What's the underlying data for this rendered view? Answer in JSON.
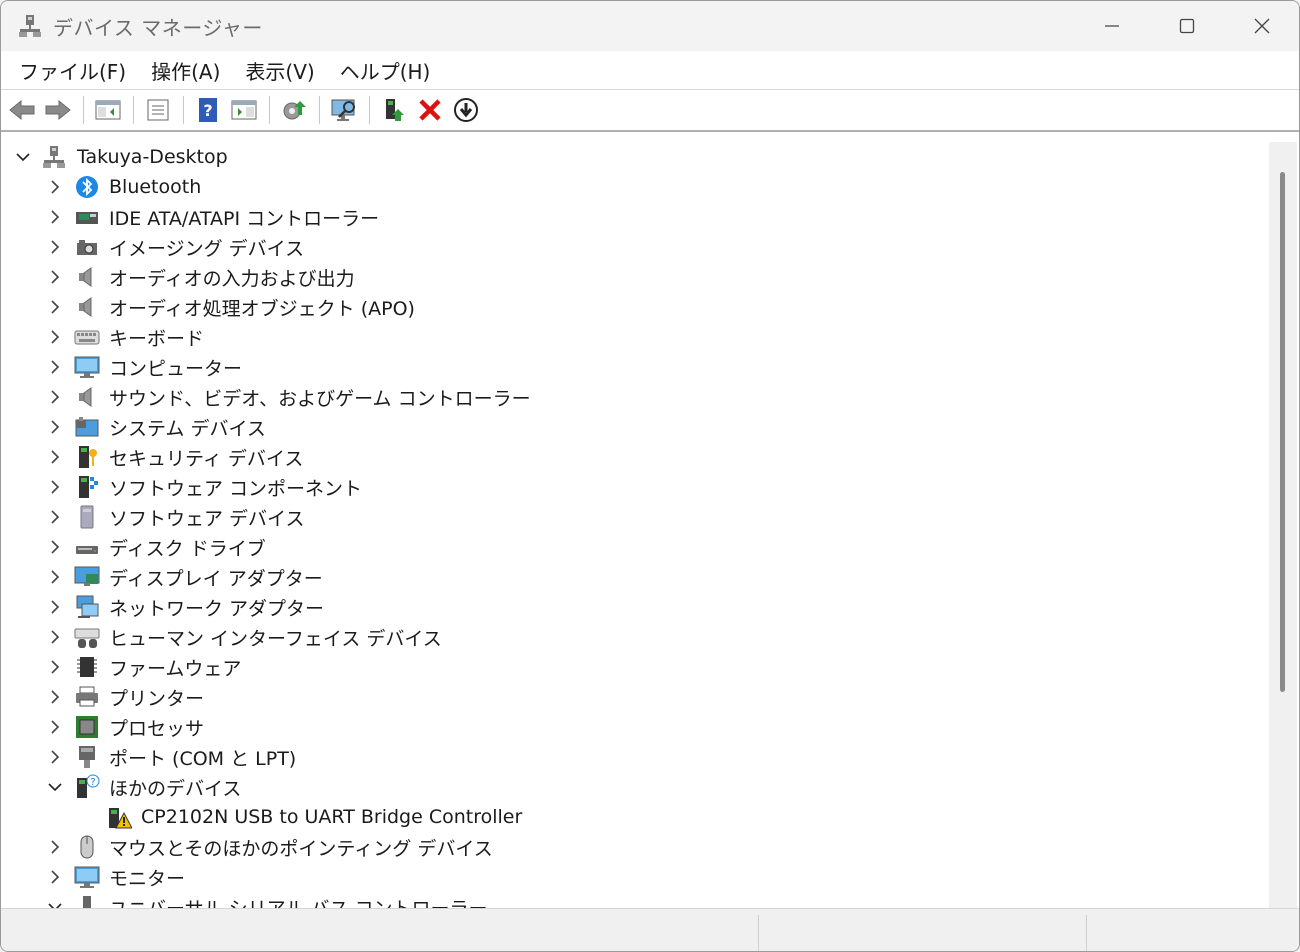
{
  "window": {
    "title": "デバイス マネージャー"
  },
  "menu": {
    "items": [
      "ファイル(F)",
      "操作(A)",
      "表示(V)",
      "ヘルプ(H)"
    ]
  },
  "toolbar": {
    "icons": [
      "back-arrow-icon",
      "forward-arrow-icon",
      "show-hide-console-tree-icon",
      "properties-icon",
      "help-icon",
      "action-pane-icon",
      "update-driver-icon",
      "scan-hardware-icon",
      "enable-device-icon",
      "uninstall-device-icon",
      "download-update-icon"
    ]
  },
  "tree": {
    "root": "Takuya-Desktop",
    "categories": [
      {
        "label": "Bluetooth",
        "expanded": false
      },
      {
        "label": "IDE ATA/ATAPI コントローラー",
        "expanded": false
      },
      {
        "label": "イメージング デバイス",
        "expanded": false
      },
      {
        "label": "オーディオの入力および出力",
        "expanded": false
      },
      {
        "label": "オーディオ処理オブジェクト (APO)",
        "expanded": false
      },
      {
        "label": "キーボード",
        "expanded": false
      },
      {
        "label": "コンピューター",
        "expanded": false
      },
      {
        "label": "サウンド、ビデオ、およびゲーム コントローラー",
        "expanded": false
      },
      {
        "label": "システム デバイス",
        "expanded": false
      },
      {
        "label": "セキュリティ デバイス",
        "expanded": false
      },
      {
        "label": "ソフトウェア コンポーネント",
        "expanded": false
      },
      {
        "label": "ソフトウェア デバイス",
        "expanded": false
      },
      {
        "label": "ディスク ドライブ",
        "expanded": false
      },
      {
        "label": "ディスプレイ アダプター",
        "expanded": false
      },
      {
        "label": "ネットワーク アダプター",
        "expanded": false
      },
      {
        "label": "ヒューマン インターフェイス デバイス",
        "expanded": false
      },
      {
        "label": "ファームウェア",
        "expanded": false
      },
      {
        "label": "プリンター",
        "expanded": false
      },
      {
        "label": "プロセッサ",
        "expanded": false
      },
      {
        "label": "ポート (COM と LPT)",
        "expanded": false
      },
      {
        "label": "ほかのデバイス",
        "expanded": true,
        "children": [
          "CP2102N USB to UART Bridge Controller"
        ]
      },
      {
        "label": "マウスとそのほかのポインティング デバイス",
        "expanded": false
      },
      {
        "label": "モニター",
        "expanded": false
      },
      {
        "label": "ユニバーサル シリアル バス コントローラー",
        "expanded": true
      }
    ]
  }
}
